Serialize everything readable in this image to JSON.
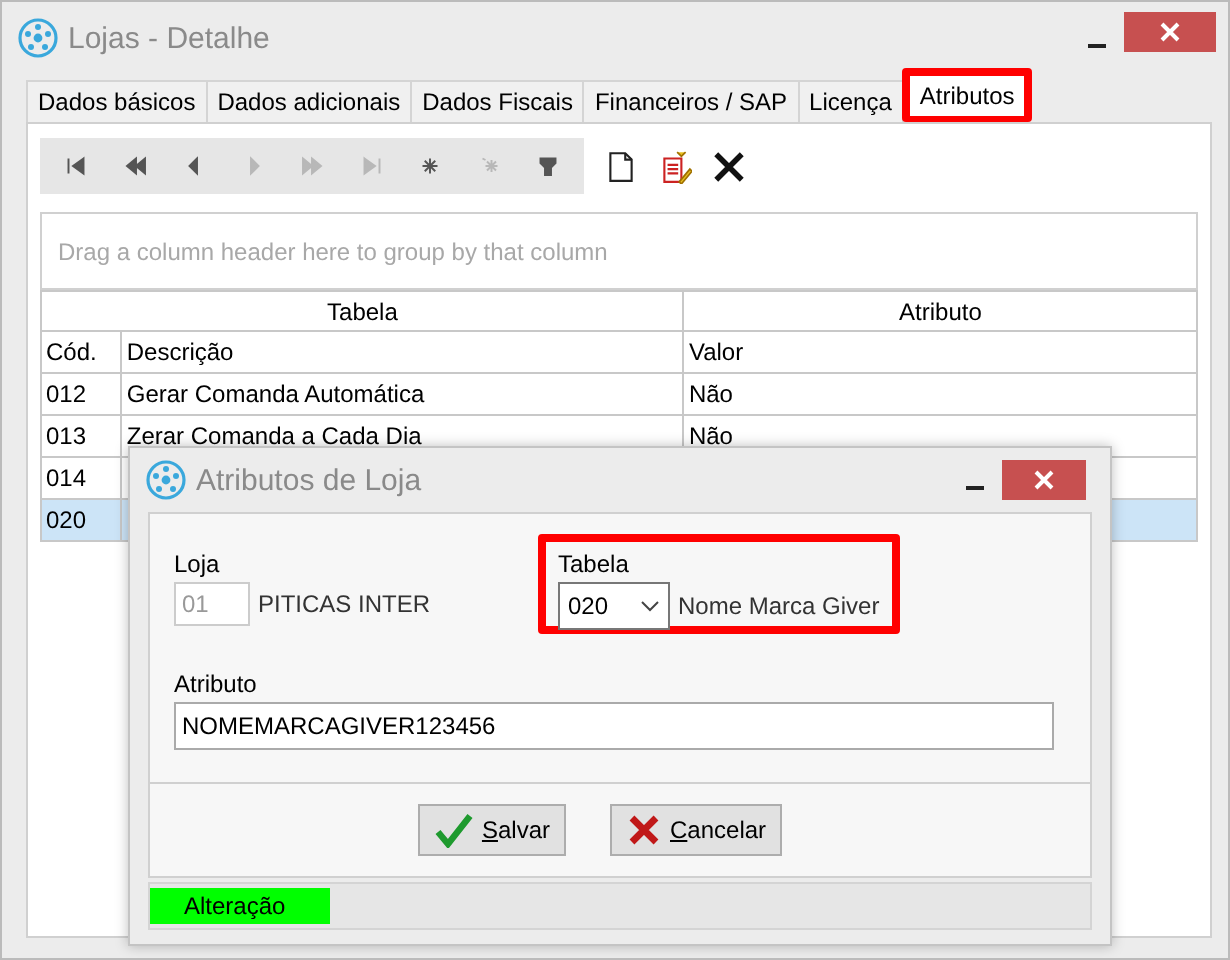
{
  "window": {
    "title": "Lojas - Detalhe"
  },
  "tabs": [
    {
      "label": "Dados básicos",
      "selected": false,
      "highlighted": false
    },
    {
      "label": "Dados adicionais",
      "selected": false,
      "highlighted": false
    },
    {
      "label": "Dados Fiscais",
      "selected": false,
      "highlighted": false
    },
    {
      "label": "Financeiros / SAP",
      "selected": false,
      "highlighted": false
    },
    {
      "label": "Licença",
      "selected": false,
      "highlighted": false
    },
    {
      "label": "Atributos",
      "selected": true,
      "highlighted": true
    }
  ],
  "toolbar": {
    "nav_buttons": [
      {
        "disabled": false
      },
      {
        "disabled": false
      },
      {
        "disabled": false
      },
      {
        "disabled": true
      },
      {
        "disabled": true
      },
      {
        "disabled": true
      },
      {
        "disabled": false
      },
      {
        "disabled": true
      },
      {
        "disabled": false
      }
    ]
  },
  "group_panel": {
    "placeholder": "Drag a column header here to group by that column"
  },
  "grid": {
    "bands": [
      "Tabela",
      "Atributo"
    ],
    "columns": [
      "Cód.",
      "Descrição",
      "Valor"
    ],
    "rows": [
      {
        "cod": "012",
        "descricao": "Gerar Comanda Automática",
        "valor": "Não",
        "selected": false
      },
      {
        "cod": "013",
        "descricao": "Zerar Comanda a Cada Dia",
        "valor": "Não",
        "selected": false
      },
      {
        "cod": "014",
        "selected": false
      },
      {
        "cod": "020",
        "selected": true
      }
    ]
  },
  "dialog": {
    "title": "Atributos de Loja",
    "loja": {
      "label": "Loja",
      "code": "01",
      "name": "PITICAS INTER",
      "disabled": true
    },
    "tabela": {
      "label": "Tabela",
      "value": "020",
      "description": "Nome Marca Giver",
      "highlighted": true
    },
    "atributo": {
      "label": "Atributo",
      "value": "NOMEMARCAGIVER123456"
    },
    "buttons": [
      {
        "label": "Salvar",
        "kind": "save"
      },
      {
        "label": "Cancelar",
        "kind": "cancel"
      }
    ],
    "status": {
      "label": "Alteração"
    }
  }
}
